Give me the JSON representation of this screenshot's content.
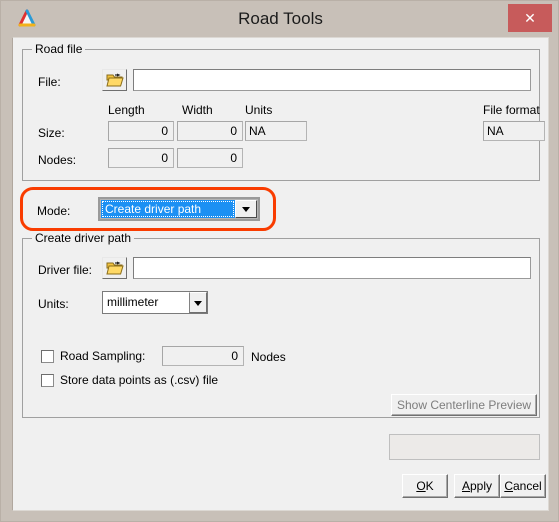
{
  "window": {
    "title": "Road Tools",
    "app_icon": "triangle-logo-icon",
    "close_label": "✕",
    "close_icon": "close-icon",
    "titlebar_color": "#c8c0b8",
    "close_button_color": "#c75b5b",
    "client_color": "#f0f0f0"
  },
  "road_file_group": {
    "title": "Road file",
    "file_label": "File:",
    "file_value": "",
    "file_placeholder": "",
    "browse_icon": "open-folder-icon",
    "columns": {
      "length": "Length",
      "width": "Width",
      "units": "Units",
      "file_format": "File format"
    },
    "rows": [
      {
        "label": "Size:",
        "length": "0",
        "width": "0",
        "units": "NA",
        "file_format": "NA"
      },
      {
        "label": "Nodes:",
        "length": "0",
        "width": "0"
      }
    ]
  },
  "mode": {
    "label": "Mode:",
    "selected": "Create driver path",
    "options": [
      "Create driver path"
    ],
    "highlight_color": "#1c90f3",
    "annotation_color": "#f93c00"
  },
  "driver_path_group": {
    "title": "Create driver path",
    "driver_file_label": "Driver file:",
    "driver_file_value": "",
    "driver_file_placeholder": "",
    "browse_icon": "open-folder-icon",
    "units_label": "Units:",
    "units_selected": "millimeter",
    "units_options": [
      "millimeter"
    ],
    "road_sampling": {
      "label": "Road Sampling:",
      "checked": false,
      "value": "0",
      "suffix": "Nodes"
    },
    "store_csv": {
      "label": "Store data points as (.csv) file",
      "checked": false
    },
    "preview_button": {
      "label": "Show Centerline Preview",
      "enabled": false
    }
  },
  "status": {
    "text": ""
  },
  "footer": {
    "ok": {
      "mnemonic": "O",
      "rest": "K"
    },
    "apply": {
      "mnemonic": "A",
      "rest": "pply"
    },
    "cancel": {
      "mnemonic": "C",
      "rest": "ancel"
    }
  }
}
